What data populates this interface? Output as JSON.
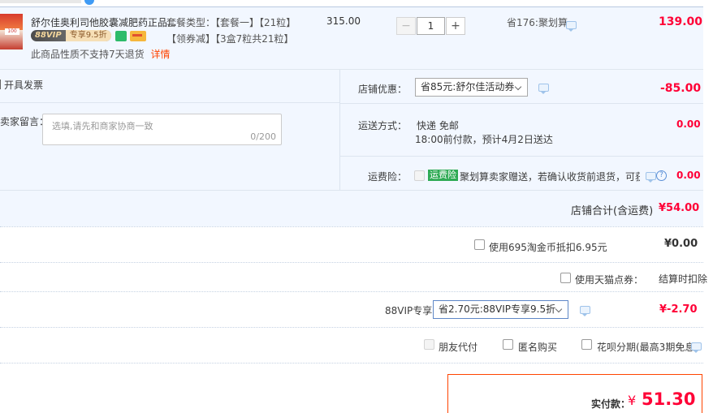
{
  "top_cut_text": "...",
  "item": {
    "title": "舒尔佳奥利司他胶囊减肥药正品...",
    "vip_badge": "88VIP",
    "vip_discount": "专享9.5折",
    "return_note": "此商品性质不支持7天退货",
    "return_link": "详情",
    "sku_label": "套餐类型：【套餐一】【21粒】",
    "coupon_label": "【领券减】【3盒7粒共21粒】",
    "unit_price": "315.00",
    "quantity": "1",
    "minus": "−",
    "plus": "+",
    "saving": "省176:聚划算",
    "subtotal": "139.00"
  },
  "left": {
    "invoice_label": "开具发票",
    "message_label": "卖家留言：",
    "message_placeholder": "选填,请先和商家协商一致",
    "message_counter": "0/200"
  },
  "shop": {
    "discount_label": "店铺优惠：",
    "discount_option": "省85元:舒尔佳活动券",
    "discount_value": "-85.00",
    "shipping_label": "运送方式：",
    "shipping_method": "快递 免邮",
    "shipping_note": "18:00前付款，预计4月2日送达",
    "shipping_value": "0.00",
    "insurance_label": "运费险：",
    "insurance_badge": "运费险",
    "insurance_text": "聚划算卖家赠送，若确认收货前退货，可获...",
    "insurance_value": "0.00",
    "shop_total_label": "店铺合计(含运费)",
    "shop_total_value": "¥54.00"
  },
  "order": {
    "taobao_coin_label": "使用695淘金币抵扣6.95元",
    "taobao_coin_value": "¥0.00",
    "tmall_points_label": "使用天猫点券：",
    "tmall_points_value": "结算时扣除",
    "vip_label": "88VIP专享",
    "vip_option": "省2.70元:88VIP专享9.5折",
    "vip_value": "¥-2.70",
    "friend_pay": "朋友代付",
    "anonymous": "匿名购买",
    "huabei": "花呗分期(最高3期免息)",
    "pay_label": "实付款：",
    "pay_currency": "¥",
    "pay_amount": "51.30"
  },
  "colors": {
    "price_red": "#ff0036",
    "row_blue": "#f2f7ff",
    "vip_gold": "#c9a063"
  }
}
